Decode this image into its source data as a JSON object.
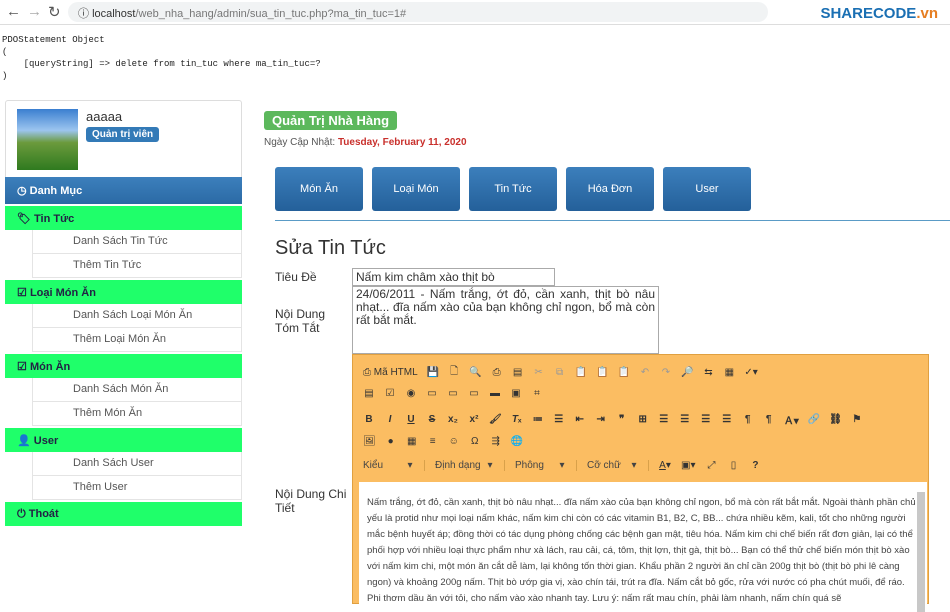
{
  "browser": {
    "url_host": "localhost",
    "url_path": "/web_nha_hang/admin/sua_tin_tuc.php?ma_tin_tuc=1#",
    "logo": "SHARECODE",
    "logo_tld": ".vn"
  },
  "debug": "PDOStatement Object\n(\n    [queryString] => delete from tin_tuc where ma_tin_tuc=?\n)",
  "sidebar": {
    "username": "aaaaa",
    "role": "Quản trị viên",
    "header": "Danh Mục",
    "groups": [
      {
        "label": "Tin Tức",
        "icon": "tag-icon",
        "items": [
          "Danh Sách Tin Tức",
          "Thêm Tin Tức"
        ]
      },
      {
        "label": "Loại Món Ăn",
        "icon": "edit-icon",
        "items": [
          "Danh Sách Loại Món Ăn",
          "Thêm Loại Món Ăn"
        ]
      },
      {
        "label": "Món Ăn",
        "icon": "edit-icon",
        "items": [
          "Danh Sách Món Ăn",
          "Thêm Món Ăn"
        ]
      },
      {
        "label": "User",
        "icon": "user-icon",
        "items": [
          "Danh Sách User",
          "Thêm User"
        ]
      }
    ],
    "logout": "Thoát"
  },
  "header": {
    "title": "Quản Trị Nhà Hàng",
    "date_label": "Ngày Cập Nhật:",
    "date": "Tuesday, February 11, 2020"
  },
  "nav": [
    "Món Ăn",
    "Loại Món",
    "Tin Tức",
    "Hóa Đơn",
    "User"
  ],
  "form": {
    "heading": "Sửa Tin Tức",
    "title_label": "Tiêu Đề",
    "title_value": "Nấm kim châm xào thịt bò",
    "summary_label": "Nội Dung Tóm Tắt",
    "summary_value": "24/06/2011 - Nấm trắng, ớt đỏ, cần xanh, thịt bò nâu nhạt... đĩa nấm xào của bạn không chỉ ngon, bổ mà còn rất bắt mắt.",
    "detail_label": "Nội Dung Chi Tiết",
    "editor": {
      "source_label": "Mã HTML",
      "styles": "Kiểu",
      "format": "Định dạng",
      "font": "Phông",
      "size": "Cỡ chữ",
      "content": "Nấm trắng, ớt đỏ, cần xanh, thịt bò nâu nhạt... đĩa nấm xào của bạn không chỉ ngon, bổ mà còn rất bắt mắt. Ngoài thành phần chủ yếu là protid như mọi loại nấm khác, nấm kim chi còn có các vitamin B1, B2, C, BB... chứa nhiều kẽm, kali, tốt cho những người mắc bệnh huyết áp; đồng thời có tác dụng phòng chống các bệnh gan mật, tiêu hóa. Nấm kim chi chế biến rất đơn giản, lại có thể phối hợp với nhiều loại thực phẩm như xà lách, rau cải, cá, tôm, thịt lợn, thịt gà, thịt bò... Bạn có thể thử chế biến món thịt bò xào với nấm kim chi, một món ăn cắt dễ làm, lại không tốn thời gian. Khẩu phần 2 người ăn chỉ cần 200g thịt bò (thịt bò phi lê càng ngon) và khoảng 200g nấm. Thịt bò ướp gia vị, xào chín tái, trút ra đĩa. Nấm cắt bỏ gốc, rửa với nước có pha chút muối, để ráo. Phi thơm dầu ăn với tỏi, cho nấm vào xào nhanh tay. Lưu ý: nấm rất mau chín, phải làm nhanh, nấm chín quá sẽ"
    }
  }
}
